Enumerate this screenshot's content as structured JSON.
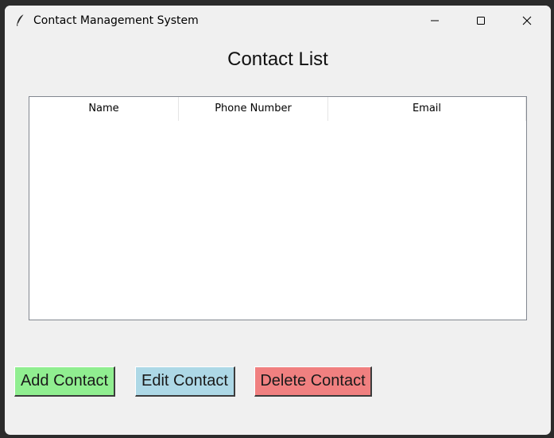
{
  "window": {
    "title": "Contact Management System",
    "icon": "feather-icon"
  },
  "heading": "Contact List",
  "table": {
    "columns": [
      "Name",
      "Phone Number",
      "Email"
    ],
    "rows": []
  },
  "buttons": {
    "add": {
      "label": "Add Contact",
      "color": "#90ee90"
    },
    "edit": {
      "label": "Edit Contact",
      "color": "#add8e6"
    },
    "delete": {
      "label": "Delete Contact",
      "color": "#f08080"
    }
  }
}
